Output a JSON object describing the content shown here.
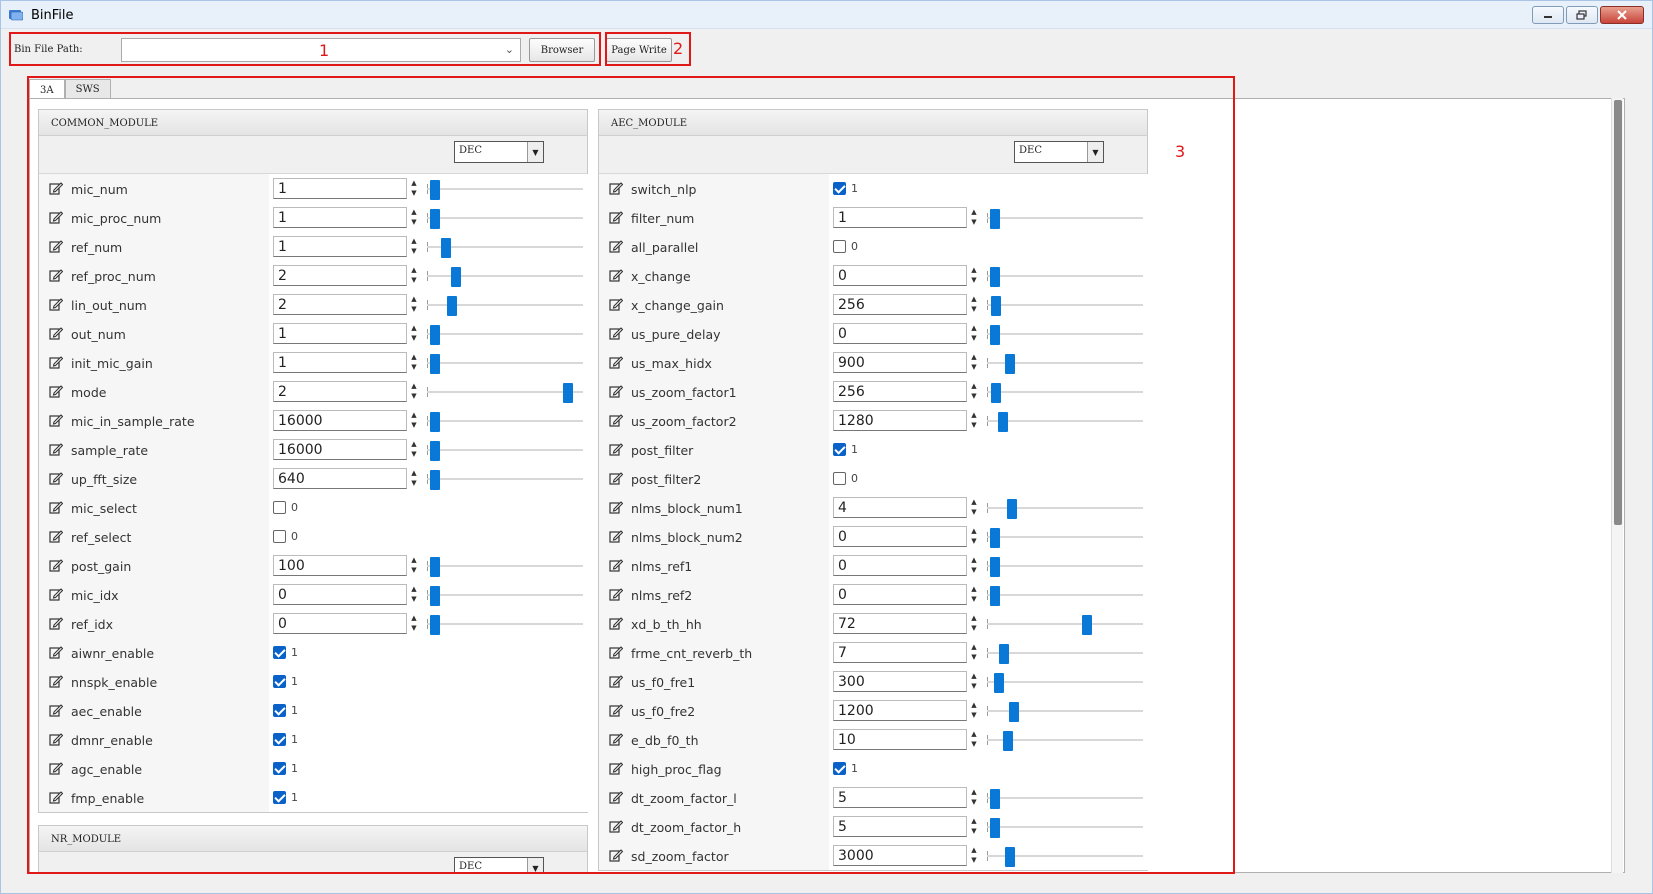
{
  "window": {
    "title": "BinFile"
  },
  "toolbar": {
    "path_label": "Bin File Path:",
    "path_value": "",
    "browser_label": "Browser",
    "page_write_label": "Page Write"
  },
  "annotations": [
    "1",
    "2",
    "3"
  ],
  "tabs": [
    {
      "label": "3A",
      "active": true
    },
    {
      "label": "SWS",
      "active": false
    }
  ],
  "modules": [
    {
      "title": "COMMON_MODULE",
      "format": "DEC",
      "rows": [
        {
          "name": "mic_num",
          "type": "num",
          "value": "1",
          "level": 0.02
        },
        {
          "name": "mic_proc_num",
          "type": "num",
          "value": "1",
          "level": 0.02
        },
        {
          "name": "ref_num",
          "type": "num",
          "value": "1",
          "level": 0.1
        },
        {
          "name": "ref_proc_num",
          "type": "num",
          "value": "2",
          "level": 0.18
        },
        {
          "name": "lin_out_num",
          "type": "num",
          "value": "2",
          "level": 0.15
        },
        {
          "name": "out_num",
          "type": "num",
          "value": "1",
          "level": 0.02
        },
        {
          "name": "init_mic_gain",
          "type": "num",
          "value": "1",
          "level": 0.02
        },
        {
          "name": "mode",
          "type": "num",
          "value": "2",
          "level": 1.0
        },
        {
          "name": "mic_in_sample_rate",
          "type": "num",
          "value": "16000",
          "level": 0.02
        },
        {
          "name": "sample_rate",
          "type": "num",
          "value": "16000",
          "level": 0.02
        },
        {
          "name": "up_fft_size",
          "type": "num",
          "value": "640",
          "level": 0.02
        },
        {
          "name": "mic_select",
          "type": "bool",
          "value": "0"
        },
        {
          "name": "ref_select",
          "type": "bool",
          "value": "0"
        },
        {
          "name": "post_gain",
          "type": "num",
          "value": "100",
          "level": 0.02
        },
        {
          "name": "mic_idx",
          "type": "num",
          "value": "0",
          "level": 0.02
        },
        {
          "name": "ref_idx",
          "type": "num",
          "value": "0",
          "level": 0.02
        },
        {
          "name": "aiwnr_enable",
          "type": "bool",
          "value": "1"
        },
        {
          "name": "nnspk_enable",
          "type": "bool",
          "value": "1"
        },
        {
          "name": "aec_enable",
          "type": "bool",
          "value": "1"
        },
        {
          "name": "dmnr_enable",
          "type": "bool",
          "value": "1"
        },
        {
          "name": "agc_enable",
          "type": "bool",
          "value": "1"
        },
        {
          "name": "fmp_enable",
          "type": "bool",
          "value": "1"
        }
      ]
    },
    {
      "title": "AEC_MODULE",
      "format": "DEC",
      "rows": [
        {
          "name": "switch_nlp",
          "type": "bool",
          "value": "1"
        },
        {
          "name": "filter_num",
          "type": "num",
          "value": "1",
          "level": 0.02
        },
        {
          "name": "all_parallel",
          "type": "bool",
          "value": "0"
        },
        {
          "name": "x_change",
          "type": "num",
          "value": "0",
          "level": 0.02
        },
        {
          "name": "x_change_gain",
          "type": "num",
          "value": "256",
          "level": 0.03
        },
        {
          "name": "us_pure_delay",
          "type": "num",
          "value": "0",
          "level": 0.02
        },
        {
          "name": "us_max_hidx",
          "type": "num",
          "value": "900",
          "level": 0.13
        },
        {
          "name": "us_zoom_factor1",
          "type": "num",
          "value": "256",
          "level": 0.03
        },
        {
          "name": "us_zoom_factor2",
          "type": "num",
          "value": "1280",
          "level": 0.08
        },
        {
          "name": "post_filter",
          "type": "bool",
          "value": "1"
        },
        {
          "name": "post_filter2",
          "type": "bool",
          "value": "0"
        },
        {
          "name": "nlms_block_num1",
          "type": "num",
          "value": "4",
          "level": 0.15
        },
        {
          "name": "nlms_block_num2",
          "type": "num",
          "value": "0",
          "level": 0.02
        },
        {
          "name": "nlms_ref1",
          "type": "num",
          "value": "0",
          "level": 0.02
        },
        {
          "name": "nlms_ref2",
          "type": "num",
          "value": "0",
          "level": 0.02
        },
        {
          "name": "xd_b_th_hh",
          "type": "num",
          "value": "72",
          "level": 0.7
        },
        {
          "name": "frme_cnt_reverb_th",
          "type": "num",
          "value": "7",
          "level": 0.09
        },
        {
          "name": "us_f0_fre1",
          "type": "num",
          "value": "300",
          "level": 0.05
        },
        {
          "name": "us_f0_fre2",
          "type": "num",
          "value": "1200",
          "level": 0.16
        },
        {
          "name": "e_db_f0_th",
          "type": "num",
          "value": "10",
          "level": 0.12
        },
        {
          "name": "high_proc_flag",
          "type": "bool",
          "value": "1"
        },
        {
          "name": "dt_zoom_factor_l",
          "type": "num",
          "value": "5",
          "level": 0.02
        },
        {
          "name": "dt_zoom_factor_h",
          "type": "num",
          "value": "5",
          "level": 0.02
        },
        {
          "name": "sd_zoom_factor",
          "type": "num",
          "value": "3000",
          "level": 0.13
        }
      ]
    },
    {
      "title": "NR_MODULE",
      "format": "DEC",
      "rows": []
    }
  ],
  "colors": {
    "accent": "#0a78d7",
    "annotation": "#e01818"
  }
}
